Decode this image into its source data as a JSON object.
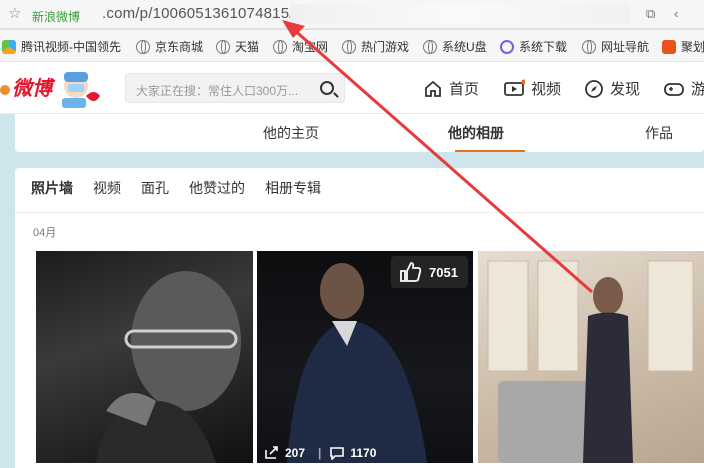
{
  "address_bar": {
    "site_name": "新浪微博",
    "url": ".com/p/1006051361074815/",
    "icons": [
      "star-icon",
      "screenshot-icon",
      "collapse-icon"
    ]
  },
  "bookmarks": [
    {
      "label": "腾讯视频-中国领先",
      "icon": "tencent-video-icon"
    },
    {
      "label": "京东商城",
      "icon": "globe-icon"
    },
    {
      "label": "天猫",
      "icon": "globe-icon"
    },
    {
      "label": "淘宝网",
      "icon": "globe-icon"
    },
    {
      "label": "热门游戏",
      "icon": "globe-icon"
    },
    {
      "label": "系统U盘",
      "icon": "globe-icon"
    },
    {
      "label": "系统下载",
      "icon": "download-icon"
    },
    {
      "label": "网址导航",
      "icon": "globe-icon"
    },
    {
      "label": "聚划",
      "icon": "juhuasuan-icon"
    }
  ],
  "header": {
    "logo_text": "微博",
    "search_placeholder": "大家正在搜：常住人口300万...",
    "nav": [
      {
        "label": "首页",
        "icon": "home-icon"
      },
      {
        "label": "视频",
        "icon": "video-icon"
      },
      {
        "label": "发现",
        "icon": "compass-icon"
      },
      {
        "label": "游戏",
        "icon": "game-icon"
      }
    ]
  },
  "profile_tabs": [
    {
      "label": "他的主页",
      "active": false
    },
    {
      "label": "他的相册",
      "active": true
    },
    {
      "label": "作品",
      "active": false
    }
  ],
  "album_tabs": [
    {
      "label": "照片墙",
      "active": true
    },
    {
      "label": "视频",
      "active": false
    },
    {
      "label": "面孔",
      "active": false
    },
    {
      "label": "他赞过的",
      "active": false
    },
    {
      "label": "相册专辑",
      "active": false
    }
  ],
  "month_label": "04月",
  "photo_stats": {
    "likes": "7051",
    "shares": "207",
    "comments": "1170"
  },
  "colors": {
    "accent": "#e8711c",
    "annotation_arrow": "#e83a3a",
    "brand_red": "#e6162d"
  }
}
